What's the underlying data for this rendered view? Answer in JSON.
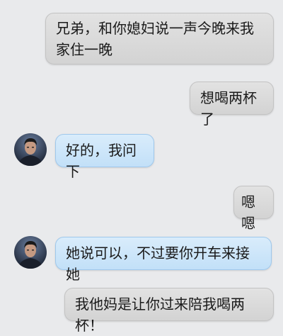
{
  "messages": [
    {
      "side": "right",
      "text": "兄弟，和你媳妇说一声今晚来我家住一晚"
    },
    {
      "side": "right",
      "text": "想喝两杯了"
    },
    {
      "side": "left",
      "text": "好的，我问下"
    },
    {
      "side": "right",
      "text": "嗯嗯"
    },
    {
      "side": "left",
      "text": "她说可以，不过要你开车来接她"
    },
    {
      "side": "right",
      "text": "我他妈是让你过来陪我喝两杯！"
    }
  ],
  "colors": {
    "background": "#e9eaec",
    "bubble_self": "#d8d8d8",
    "bubble_other": "#c6e2f9"
  },
  "icons": {
    "contact_avatar": "avatar"
  }
}
